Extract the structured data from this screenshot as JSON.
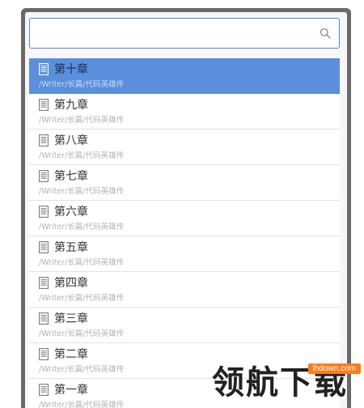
{
  "search": {
    "value": "",
    "placeholder": ""
  },
  "results": [
    {
      "title": "第十章",
      "path": "/Writer/长篇/代码英雄传",
      "selected": true
    },
    {
      "title": "第九章",
      "path": "/Writer/长篇/代码英雄传"
    },
    {
      "title": "第八章",
      "path": "/Writer/长篇/代码英雄传"
    },
    {
      "title": "第七章",
      "path": "/Writer/长篇/代码英雄传"
    },
    {
      "title": "第六章",
      "path": "/Writer/长篇/代码英雄传"
    },
    {
      "title": "第五章",
      "path": "/Writer/长篇/代码英雄传"
    },
    {
      "title": "第四章",
      "path": "/Writer/长篇/代码英雄传"
    },
    {
      "title": "第三章",
      "path": "/Writer/长篇/代码英雄传"
    },
    {
      "title": "第二章",
      "path": "/Writer/长篇/代码英雄传"
    },
    {
      "title": "第一章",
      "path": "/Writer/长篇/代码英雄传"
    }
  ],
  "icons": {
    "search": "search-icon",
    "document": "document-icon"
  },
  "colors": {
    "selected_row": "#5b8fdc",
    "search_border": "#5a7fd8",
    "frame": "#6a6a6a"
  },
  "watermark": {
    "text": "领航下载",
    "url": "lhdown.com"
  }
}
